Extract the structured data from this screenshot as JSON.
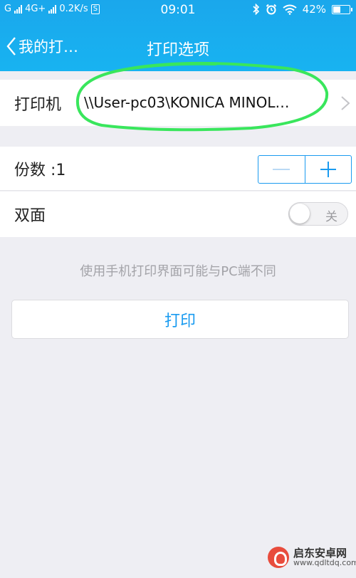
{
  "status_bar": {
    "carrier1": "G",
    "network": "4G+",
    "speed": "0.2K/s",
    "sim_badge": "S",
    "time": "09:01",
    "battery": "42%",
    "icons": [
      "signal-icon",
      "bluetooth-icon",
      "alarm-icon",
      "wifi-icon",
      "battery-icon"
    ]
  },
  "nav": {
    "back_label": "我的打…",
    "title": "打印选项"
  },
  "printer": {
    "label": "打印机",
    "value": "\\\\User-pc03\\KONICA MINOL…"
  },
  "copies": {
    "label": "份数 :1"
  },
  "duplex": {
    "label": "双面",
    "toggle_text": "关",
    "on": false
  },
  "hint": "使用手机打印界面可能与PC端不同",
  "print_button": "打印",
  "watermark": {
    "name": "启东安卓网",
    "url": "www.qdltdq.com"
  },
  "colors": {
    "header": "#1aa7ec",
    "accent": "#1a9bf0",
    "annotation_circle": "#39e65c",
    "background": "#eeeef3"
  }
}
